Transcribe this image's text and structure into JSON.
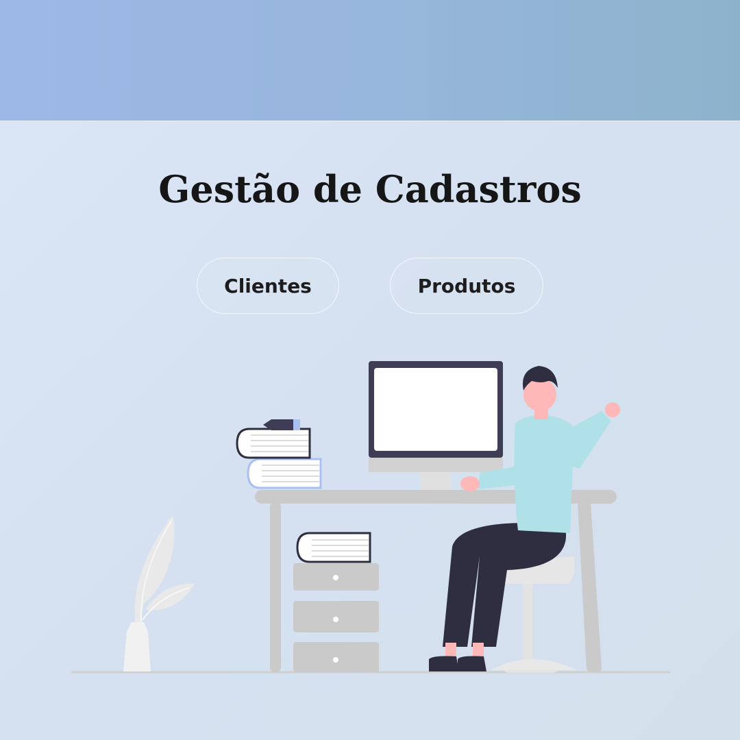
{
  "header": {
    "title": "Gestão de Cadastros"
  },
  "nav": {
    "items": [
      {
        "label": "Clientes"
      },
      {
        "label": "Produtos"
      }
    ]
  },
  "colors": {
    "topbar": "#97b6dc",
    "background": "#d8e3f3",
    "button_border": "#f4f7fc",
    "text": "#161616"
  }
}
